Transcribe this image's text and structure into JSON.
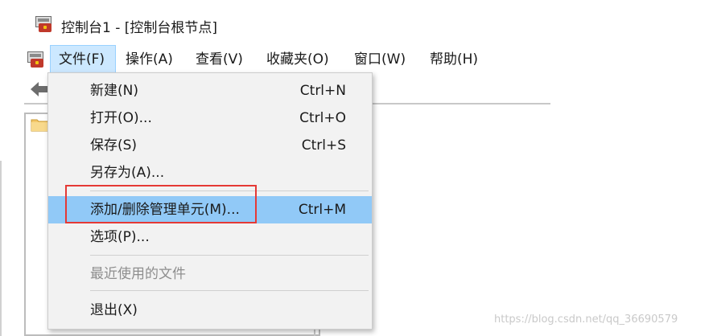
{
  "window": {
    "title": "控制台1 - [控制台根节点]"
  },
  "menubar": {
    "items": [
      {
        "label": "文件(F)"
      },
      {
        "label": "操作(A)"
      },
      {
        "label": "查看(V)"
      },
      {
        "label": "收藏夹(O)"
      },
      {
        "label": "窗口(W)"
      },
      {
        "label": "帮助(H)"
      }
    ]
  },
  "file_menu": {
    "items": [
      {
        "label": "新建(N)",
        "shortcut": "Ctrl+N"
      },
      {
        "label": "打开(O)...",
        "shortcut": "Ctrl+O"
      },
      {
        "label": "保存(S)",
        "shortcut": "Ctrl+S"
      },
      {
        "label": "另存为(A)...",
        "shortcut": ""
      },
      {
        "label": "添加/删除管理单元(M)...",
        "shortcut": "Ctrl+M",
        "highlighted": true
      },
      {
        "label": "选项(P)...",
        "shortcut": ""
      },
      {
        "label": "最近使用的文件",
        "shortcut": "",
        "disabled": true
      },
      {
        "label": "退出(X)",
        "shortcut": ""
      }
    ]
  },
  "colors": {
    "highlight": "#91c9f7",
    "annotation": "#e53935",
    "menu_background": "#f2f2f2"
  },
  "icons": {
    "app": "console-toolbox-icon",
    "back": "back-arrow-icon",
    "folder": "folder-icon"
  },
  "watermark": "https://blog.csdn.net/qq_36690579"
}
